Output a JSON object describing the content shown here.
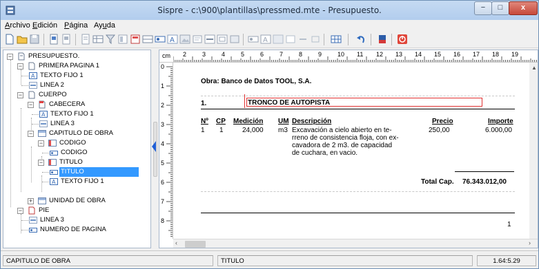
{
  "window": {
    "title": "Sispre - c:\\900\\plantillas\\pressmed.mte - Presupuesto.",
    "min": "−",
    "max": "□",
    "close": "x"
  },
  "menu": {
    "items": [
      {
        "pre": "",
        "u": "A",
        "post": "rchivo"
      },
      {
        "pre": "",
        "u": "E",
        "post": "dición"
      },
      {
        "pre": "",
        "u": "P",
        "post": "ágina"
      },
      {
        "pre": "Ay",
        "u": "u",
        "post": "da"
      }
    ]
  },
  "tree": {
    "nodes": [
      {
        "label": "PRESUPUESTO.",
        "icon": "document-icon",
        "level": 0,
        "expanded": true
      },
      {
        "label": "PRIMERA PAGINA 1",
        "icon": "page-icon",
        "level": 1,
        "expanded": true
      },
      {
        "label": "TEXTO FIJO 1",
        "icon": "text-icon",
        "level": 2
      },
      {
        "label": "LINEA 2",
        "icon": "line-icon",
        "level": 2
      },
      {
        "label": "CUERPO",
        "icon": "page-icon",
        "level": 1,
        "expanded": true
      },
      {
        "label": "CABECERA",
        "icon": "header-page-icon",
        "level": 2,
        "expanded": true
      },
      {
        "label": "TEXTO FIJO 1",
        "icon": "text-icon",
        "level": 3
      },
      {
        "label": "LINEA 3",
        "icon": "line-icon",
        "level": 3
      },
      {
        "label": "CAPITULO DE OBRA",
        "icon": "section-icon",
        "level": 2,
        "expanded": true
      },
      {
        "label": "CODIGO",
        "icon": "table-icon",
        "level": 3,
        "expanded": true
      },
      {
        "label": "CODIGO",
        "icon": "field-icon",
        "level": 4
      },
      {
        "label": "TITULO",
        "icon": "table-icon",
        "level": 3,
        "expanded": true
      },
      {
        "label": "TITULO",
        "icon": "field-icon",
        "level": 4,
        "selected": true
      },
      {
        "label": "TEXTO FIJO 1",
        "icon": "text-icon",
        "level": 4
      },
      {
        "label": "UNIDAD DE OBRA",
        "icon": "section-icon",
        "level": 2,
        "expanded": false
      },
      {
        "label": "PIE",
        "icon": "footer-page-icon",
        "level": 1,
        "expanded": true
      },
      {
        "label": "LINEA 3",
        "icon": "line-icon",
        "level": 2
      },
      {
        "label": "NUMERO DE PAGINA",
        "icon": "field-icon",
        "level": 2
      }
    ]
  },
  "ruler": {
    "unit": "cm",
    "h_numbers": [
      "2",
      "3",
      "4",
      "5",
      "6",
      "7",
      "8",
      "9",
      "10",
      "11",
      "12",
      "13",
      "14",
      "15",
      "16",
      "17",
      "18",
      "19"
    ],
    "v_numbers": [
      "0",
      "1",
      "2",
      "3",
      "4",
      "5",
      "6",
      "7",
      "8"
    ]
  },
  "document": {
    "obra": "Obra: Banco de Datos TOOL, S.A.",
    "chapter_num": "1.",
    "chapter_title": "TRONCO DE AUTOPISTA",
    "headers": {
      "n": "Nº",
      "cp": "CP",
      "medicion": "Medición",
      "um": "UM",
      "descripcion": "Descripción",
      "precio": "Precio",
      "importe": "Importe"
    },
    "row": {
      "n": "1",
      "cp": "1",
      "medicion": "24,000",
      "um": "m3",
      "descripcion": [
        "Excavación a cielo abierto en te-",
        "rreno de consistencia floja, con ex-",
        "cavadora de 2 m3. de capacidad",
        "de cuchara, en vacio."
      ],
      "precio": "250,00",
      "importe": "6.000,00"
    },
    "total_label": "Total Cap.",
    "total_value": "76.343.012,00",
    "page_number": "1"
  },
  "status": {
    "left": "CAPITULO DE OBRA",
    "middle": "TITULO",
    "right": "1.64:5.29"
  },
  "colors": {
    "selection": "#3399ff",
    "red_box": "#e03030",
    "splitter_arrow": "#1f5fd6"
  }
}
